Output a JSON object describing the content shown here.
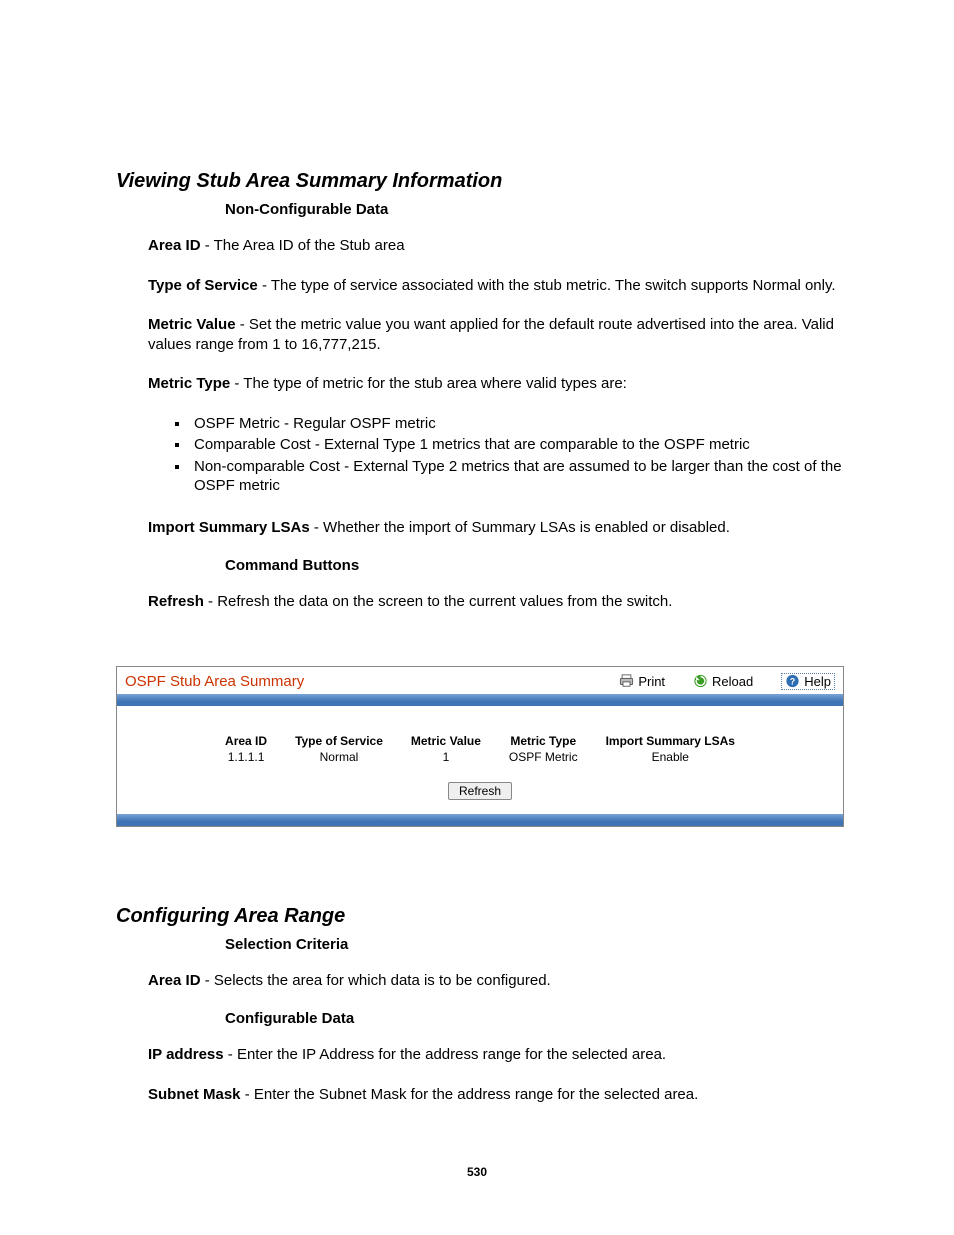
{
  "section1": {
    "title": "Viewing Stub Area Summary Information",
    "sub_nonconfig": "Non-Configurable Data",
    "area_id_label": "Area ID",
    "area_id_text": " - The Area ID of the Stub area",
    "tos_label": "Type of Service",
    "tos_text": " - The type of service associated with the stub metric. The switch supports Normal only.",
    "metric_value_label": "Metric Value",
    "metric_value_text": " - Set the metric value you want applied for the default route advertised into the area. Valid values range from 1 to 16,777,215.",
    "metric_type_label": "Metric Type",
    "metric_type_text": " - The type of metric for the stub area where valid types are:",
    "metric_items": [
      "OSPF Metric - Regular OSPF metric",
      "Comparable Cost - External Type 1 metrics that are comparable to the OSPF metric",
      "Non-comparable Cost - External Type 2 metrics that are assumed to be larger than the cost of the OSPF metric"
    ],
    "import_label": "Import Summary LSAs",
    "import_text": " - Whether the import of Summary LSAs is enabled or disabled.",
    "sub_cmd": "Command Buttons",
    "refresh_label": "Refresh",
    "refresh_text": " - Refresh the data on the screen to the current values from the switch."
  },
  "panel": {
    "title": "OSPF Stub Area Summary",
    "print": "Print",
    "reload": "Reload",
    "help": "Help",
    "headers": {
      "area_id": "Area ID",
      "tos": "Type of Service",
      "mval": "Metric Value",
      "mtype": "Metric Type",
      "import": "Import Summary LSAs"
    },
    "row": {
      "area_id": "1.1.1.1",
      "tos": "Normal",
      "mval": "1",
      "mtype": "OSPF Metric",
      "import": "Enable"
    },
    "refresh_btn": "Refresh"
  },
  "section2": {
    "title": "Configuring Area Range",
    "sub_selection": "Selection Criteria",
    "area_id_label": "Area ID",
    "area_id_text": " - Selects the area for which data is to be configured.",
    "sub_config": "Configurable Data",
    "ip_label": "IP address",
    "ip_text": " - Enter the IP Address for the address range for the selected area.",
    "mask_label": "Subnet Mask",
    "mask_text": " - Enter the Subnet Mask for the address range for the selected area."
  },
  "page_number": "530"
}
